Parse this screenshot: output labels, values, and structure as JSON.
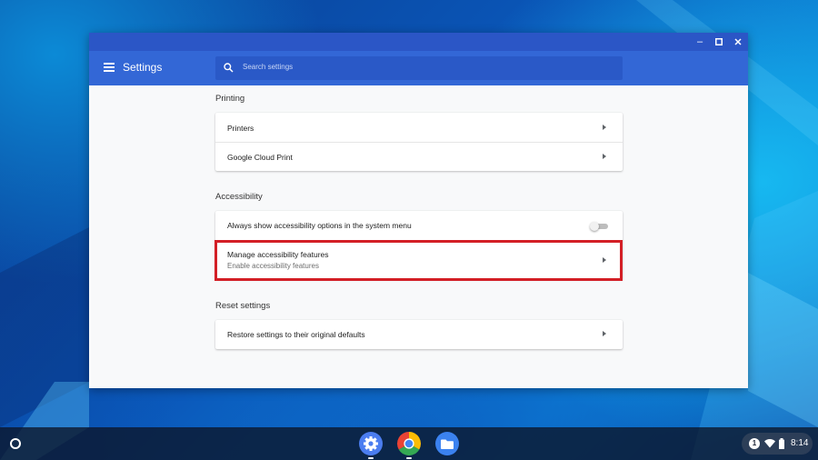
{
  "window": {
    "title": "Settings",
    "search_placeholder": "Search settings",
    "controls": {
      "minimize": "–",
      "maximize": "☐",
      "close": "✕"
    }
  },
  "sections": [
    {
      "title": "Printing",
      "rows": [
        {
          "label": "Printers"
        },
        {
          "label": "Google Cloud Print"
        }
      ]
    },
    {
      "title": "Accessibility",
      "rows": [
        {
          "label": "Always show accessibility options in the system menu",
          "toggle": false
        },
        {
          "label": "Manage accessibility features",
          "sublabel": "Enable accessibility features"
        }
      ]
    },
    {
      "title": "Reset settings",
      "rows": [
        {
          "label": "Restore settings to their original defaults"
        }
      ]
    }
  ],
  "shelf": {
    "apps": [
      {
        "name": "Settings",
        "icon": "gear-icon"
      },
      {
        "name": "Chrome",
        "icon": "chrome-icon"
      },
      {
        "name": "Files",
        "icon": "folder-icon"
      }
    ],
    "tray": {
      "notification_count": "1",
      "time": "8:14"
    }
  },
  "colors": {
    "titlebar": "#2b56c6",
    "appbar": "#3367d6",
    "highlight": "#d31f26"
  }
}
